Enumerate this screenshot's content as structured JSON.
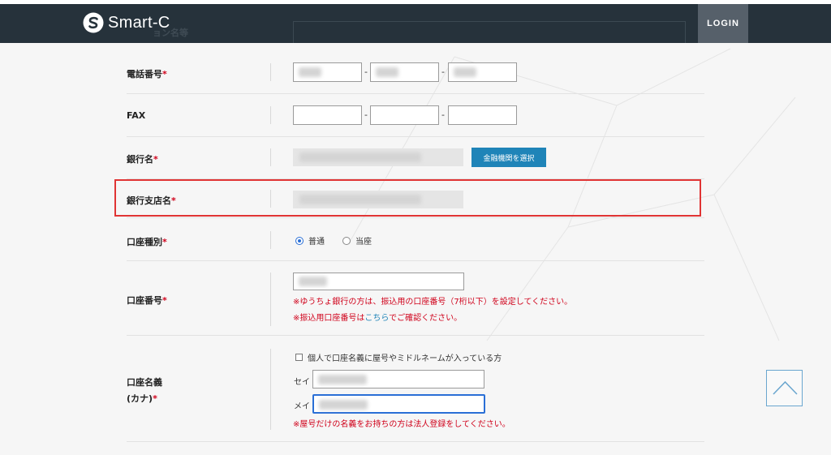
{
  "header": {
    "logo_text": "Smart-C",
    "login_label": "LOGIN",
    "faded_label": "ョン名等"
  },
  "form": {
    "phone": {
      "label": "電話番号",
      "required": "*",
      "separator": "-"
    },
    "fax": {
      "label": "FAX",
      "separator": "-"
    },
    "bank": {
      "label": "銀行名",
      "required": "*",
      "select_button": "金融機関を選択"
    },
    "branch": {
      "label": "銀行支店名",
      "required": "*"
    },
    "account_type": {
      "label": "口座種別",
      "required": "*",
      "options": [
        {
          "label": "普通",
          "checked": true
        },
        {
          "label": "当座",
          "checked": false
        }
      ]
    },
    "account_number": {
      "label": "口座番号",
      "required": "*",
      "note1": "※ゆうちょ銀行の方は、振込用の口座番号（7桁以下）を設定してください。",
      "note2_prefix": "※振込用口座番号は",
      "note2_link": "こちら",
      "note2_suffix": "でご確認ください。"
    },
    "account_name": {
      "label_line1": "口座名義",
      "label_line2": "(カナ)",
      "required": "*",
      "checkbox_label": "個人で口座名義に屋号やミドルネームが入っている方",
      "sei_label": "セイ",
      "mei_label": "メイ",
      "note": "※屋号だけの名義をお持ちの方は法人登録をしてください。"
    }
  },
  "colors": {
    "header_bg": "#26323b",
    "accent_blue": "#1f84b8",
    "required_red": "#d0021b",
    "highlight_red": "#e03434"
  },
  "icons": {
    "logo": "smart-c-logo-icon",
    "scroll_top": "chevron-up-icon"
  }
}
